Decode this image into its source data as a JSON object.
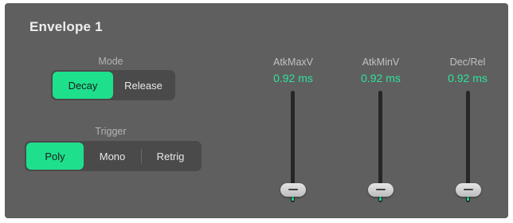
{
  "title": "Envelope 1",
  "mode": {
    "label": "Mode",
    "options": [
      "Decay",
      "Release"
    ],
    "selected": "Decay"
  },
  "trigger": {
    "label": "Trigger",
    "options": [
      "Poly",
      "Mono",
      "Retrig"
    ],
    "selected": "Poly"
  },
  "sliders": [
    {
      "name": "AtkMaxV",
      "value": "0.92 ms",
      "level": 0.0
    },
    {
      "name": "AtkMinV",
      "value": "0.92 ms",
      "level": 0.0
    },
    {
      "name": "Dec/Rel",
      "value": "0.92 ms",
      "level": 0.0
    }
  ],
  "colors": {
    "accent": "#1ee08c",
    "value_text": "#2ee39a",
    "panel_bg": "#5f5f5f"
  }
}
